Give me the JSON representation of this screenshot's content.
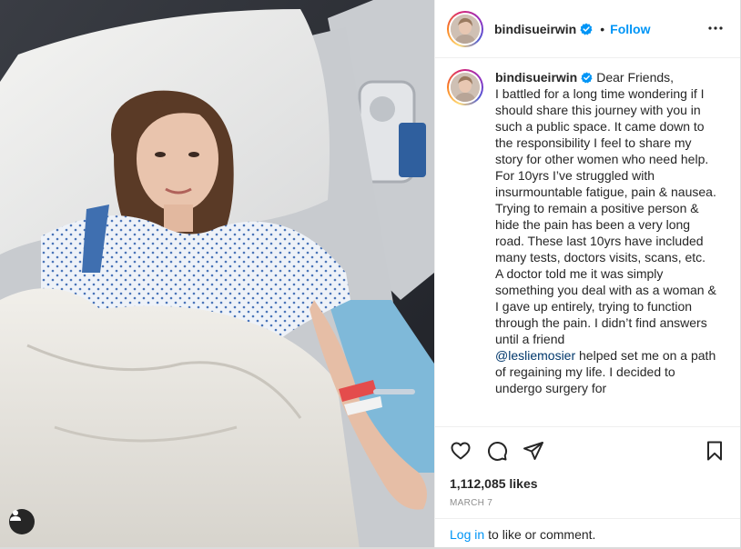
{
  "post": {
    "username": "bindisueirwin",
    "follow_label": "Follow",
    "caption": {
      "username": "bindisueirwin",
      "part1": "Dear Friends,\nI battled for a long time wondering if I should share this journey with you in such a public space. It came down to the responsibility I feel to share my story for other women who need help.\nFor 10yrs I’ve struggled with insurmountable fatigue, pain & nausea. Trying to remain a positive person & hide the pain has been a very long road. These last 10yrs have included many tests, doctors visits, scans, etc.\nA doctor told me it was simply something you deal with as a woman & I gave up entirely, trying to function through the pain. I didn’t find answers until a friend\n",
      "mention": "@lesliemosier",
      "part2": " helped set me on a path of regaining my life. I decided to undergo surgery for"
    },
    "likes": "1,112,085 likes",
    "date": "March 7",
    "login_link": "Log in",
    "login_suffix": "to like or comment."
  },
  "colors": {
    "accent": "#0095f6",
    "verified": "#0095f6",
    "mention": "#00376b"
  },
  "icons": [
    "verified-badge-icon",
    "more-options-icon",
    "heart-icon",
    "comment-icon",
    "share-icon",
    "bookmark-icon",
    "user-tag-icon"
  ]
}
